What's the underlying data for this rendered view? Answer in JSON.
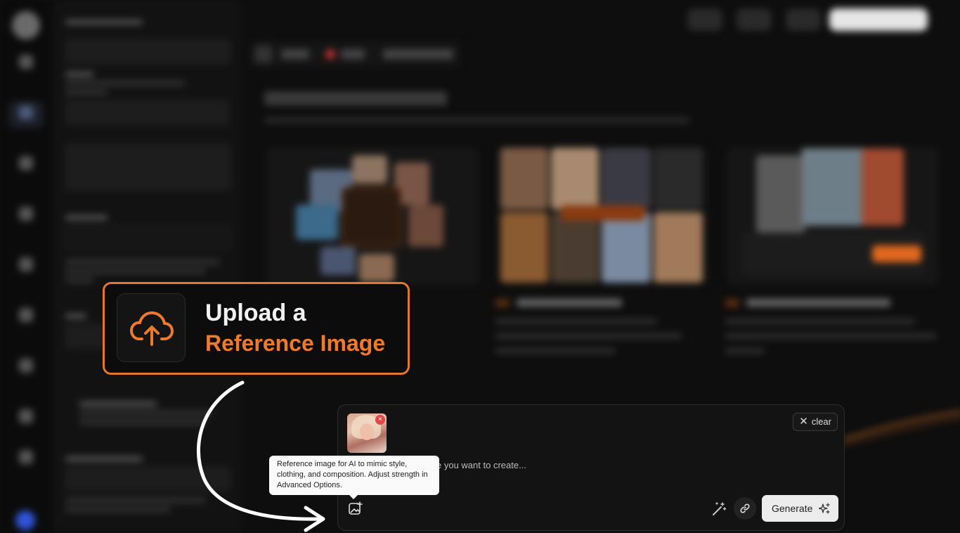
{
  "callout": {
    "line1": "Upload a",
    "line2": "Reference Image",
    "accent_color": "#ef7a2c",
    "icon": "cloud-upload-icon"
  },
  "composer": {
    "clear_label": "clear",
    "prompt_visible_text": "e you want to create...",
    "generate_label": "Generate",
    "reference_thumbnail_remove": "×"
  },
  "tooltip": {
    "text": "Reference image for AI to mimic style, clothing, and composition. Adjust strength in Advanced Options."
  },
  "icons": {
    "upload_image": "image-plus-icon",
    "magic": "magic-wand-icon",
    "link": "link-icon",
    "generate": "sparkles-icon",
    "clear": "close-icon"
  }
}
